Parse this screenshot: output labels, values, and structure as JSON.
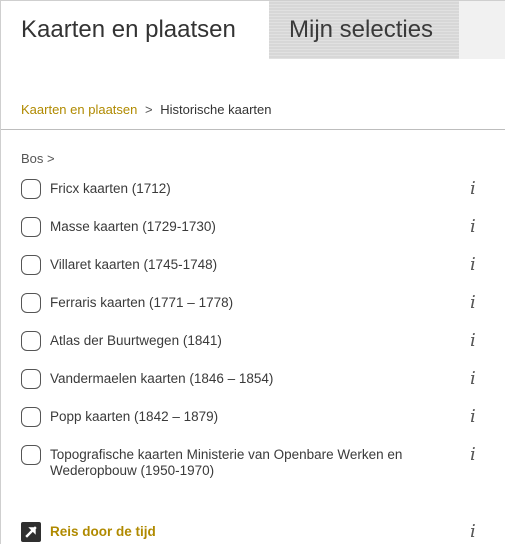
{
  "tabs": {
    "active": "Kaarten en plaatsen",
    "inactive": "Mijn selecties"
  },
  "breadcrumb": {
    "root": "Kaarten en plaatsen",
    "separator": ">",
    "current": "Historische kaarten"
  },
  "subfolder": {
    "label": "Bos",
    "arrow": ">"
  },
  "layers": [
    {
      "label": "Fricx kaarten (1712)",
      "checked": false,
      "info": "i"
    },
    {
      "label": "Masse kaarten (1729-1730)",
      "checked": false,
      "info": "i"
    },
    {
      "label": "Villaret kaarten (1745-1748)",
      "checked": false,
      "info": "i"
    },
    {
      "label": "Ferraris kaarten (1771 – 1778)",
      "checked": false,
      "info": "i"
    },
    {
      "label": "Atlas der Buurtwegen (1841)",
      "checked": false,
      "info": "i"
    },
    {
      "label": "Vandermaelen kaarten (1846 – 1854)",
      "checked": false,
      "info": "i"
    },
    {
      "label": "Popp kaarten (1842 – 1879)",
      "checked": false,
      "info": "i"
    },
    {
      "label": "Topografische kaarten Ministerie van Openbare Werken en Wederopbouw (1950-1970)",
      "checked": false,
      "info": "i"
    }
  ],
  "external_link": {
    "label": "Reis door de tijd",
    "icon": "external-link-icon",
    "info": "i"
  },
  "colors": {
    "link": "#b08a00",
    "tab_inactive": "#d7d7d7",
    "text": "#333333"
  }
}
